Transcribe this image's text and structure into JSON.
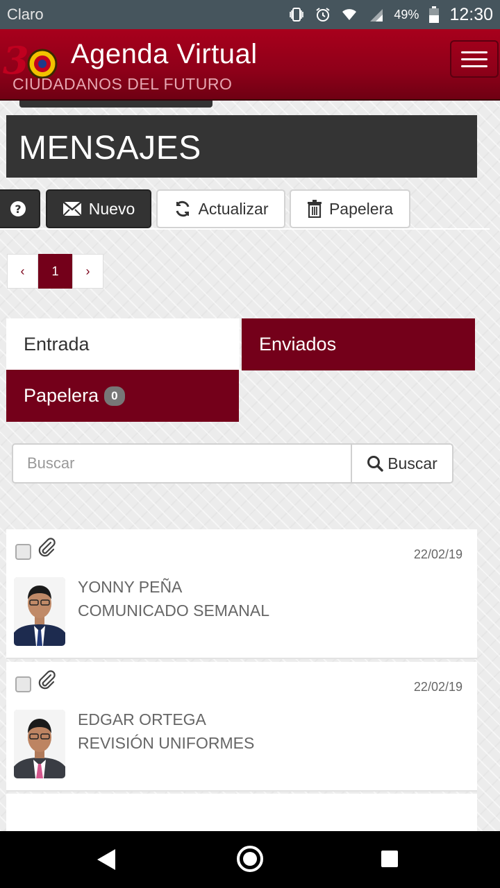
{
  "status_bar": {
    "carrier": "Claro",
    "battery": "49%",
    "time": "12:30"
  },
  "app": {
    "title": "Agenda Virtual",
    "subtitle": "CIUDADANOS DEL FUTURO"
  },
  "page": {
    "title": "MENSAJES"
  },
  "toolbar": {
    "help_label": "?",
    "new_label": "Nuevo",
    "refresh_label": "Actualizar",
    "trash_label": "Papelera"
  },
  "pagination": {
    "prev": "‹",
    "current": "1",
    "next": "›"
  },
  "tabs": {
    "inbox": "Entrada",
    "sent": "Enviados",
    "trash": "Papelera",
    "trash_count": "0"
  },
  "search": {
    "placeholder": "Buscar",
    "value": "",
    "button_label": "Buscar"
  },
  "messages": [
    {
      "date": "22/02/19",
      "sender": "YONNY PEÑA",
      "subject": "COMUNICADO SEMANAL"
    },
    {
      "date": "22/02/19",
      "sender": "EDGAR ORTEGA",
      "subject": "REVISIÓN UNIFORMES"
    }
  ],
  "colors": {
    "brand": "#8e0019",
    "tab_active": "#74001a",
    "dark": "#343434"
  }
}
